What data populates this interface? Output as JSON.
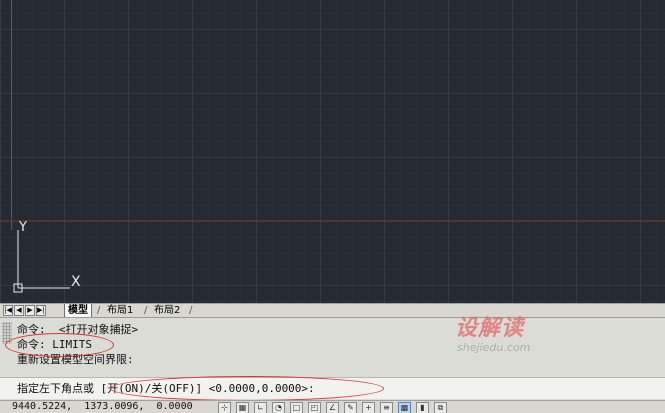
{
  "canvas": {
    "ucs_y_label": "Y",
    "ucs_x_label": "X"
  },
  "layout_tabs": {
    "nav_buttons": [
      "|◀",
      "◀",
      "▶",
      "▶|"
    ],
    "tabs": [
      {
        "label": "模型",
        "active": true
      },
      {
        "label": "布局1",
        "active": false
      },
      {
        "label": "布局2",
        "active": false
      }
    ]
  },
  "command": {
    "history": [
      "命令:  <打开对象捕捉>",
      "命令: LIMITS",
      "重新设置模型空间界限:"
    ],
    "prompt": "指定左下角点或 [开(ON)/关(OFF)] <0.0000,0.0000>:"
  },
  "watermark": {
    "brand": "设解读",
    "domain": "shejiedu.com"
  },
  "status": {
    "coordinates": "9440.5224,  1373.0096,  0.0000",
    "toggles": [
      {
        "icon": "snap-icon",
        "on": false
      },
      {
        "icon": "grid-icon",
        "on": false
      },
      {
        "icon": "ortho-icon",
        "on": false
      },
      {
        "icon": "polar-icon",
        "on": false
      },
      {
        "icon": "osnap-icon",
        "on": false
      },
      {
        "icon": "3d-osnap-icon",
        "on": false
      },
      {
        "icon": "otrack-icon",
        "on": false
      },
      {
        "icon": "ducs-icon",
        "on": false
      },
      {
        "icon": "dyn-icon",
        "on": false
      },
      {
        "icon": "lineweight-icon",
        "on": false
      },
      {
        "icon": "transparency-icon",
        "on": true
      },
      {
        "icon": "quick-properties-icon",
        "on": false
      },
      {
        "icon": "selection-cycling-icon",
        "on": false
      }
    ]
  }
}
